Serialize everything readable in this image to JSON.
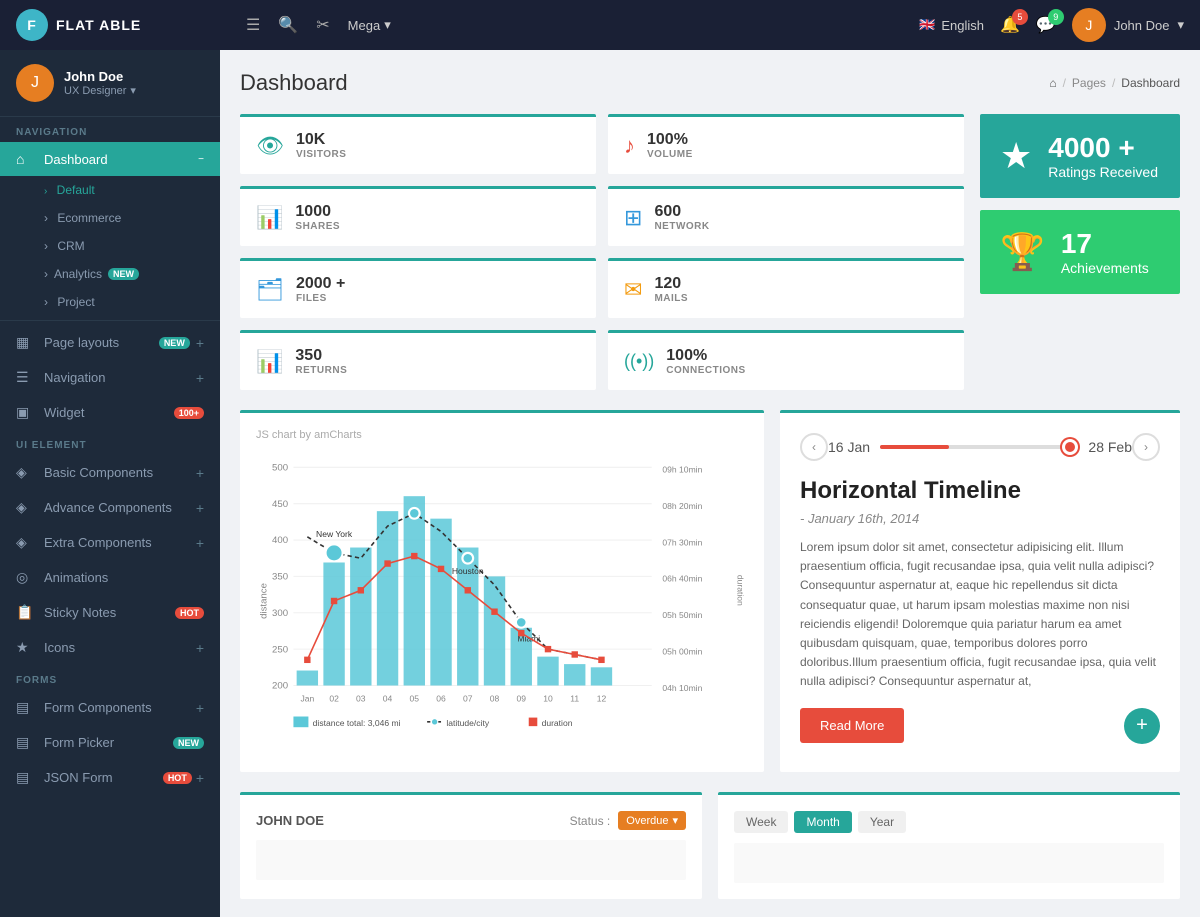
{
  "app": {
    "name": "FLAT ABLE",
    "logo_char": "F"
  },
  "topnav": {
    "hamburger": "☰",
    "search_icon": "🔍",
    "scissors_icon": "✂",
    "mega_label": "Mega",
    "lang": "English",
    "user_name": "John Doe",
    "notif_count": "5",
    "chat_count": "9"
  },
  "sidebar": {
    "user_name": "John Doe",
    "user_role": "UX Designer",
    "nav_section": "NAVIGATION",
    "ui_section": "UI ELEMENT",
    "forms_section": "FORMS",
    "items": [
      {
        "label": "Dashboard",
        "icon": "⌂",
        "active": true
      },
      {
        "label": "Default",
        "sub": true,
        "active": true
      },
      {
        "label": "Ecommerce",
        "sub": true
      },
      {
        "label": "CRM",
        "sub": true
      },
      {
        "label": "Analytics",
        "sub": true,
        "badge": "NEW",
        "badge_type": "new"
      },
      {
        "label": "Project",
        "sub": true
      },
      {
        "label": "Page layouts",
        "icon": "▦",
        "badge": "NEW",
        "badge_type": "new",
        "plus": true
      },
      {
        "label": "Navigation",
        "icon": "☰",
        "plus": true
      },
      {
        "label": "Widget",
        "icon": "▣",
        "badge": "100+",
        "badge_type": "hot"
      },
      {
        "label": "Basic Components",
        "icon": "◈",
        "plus": true
      },
      {
        "label": "Advance Components",
        "icon": "◈",
        "plus": true
      },
      {
        "label": "Extra Components",
        "icon": "◈",
        "plus": true
      },
      {
        "label": "Animations",
        "icon": "◎"
      },
      {
        "label": "Sticky Notes",
        "icon": "📋",
        "badge": "HOT",
        "badge_type": "hot"
      },
      {
        "label": "Icons",
        "icon": "★",
        "plus": true
      },
      {
        "label": "Form Components",
        "icon": "▤",
        "plus": true
      },
      {
        "label": "Form Picker",
        "icon": "▤",
        "badge": "NEW",
        "badge_type": "new"
      },
      {
        "label": "JSON Form",
        "icon": "▤",
        "badge": "HOT",
        "badge_type": "hot",
        "plus": true
      }
    ]
  },
  "page": {
    "title": "Dashboard",
    "breadcrumb": [
      "Pages",
      "Dashboard"
    ]
  },
  "stats": [
    {
      "value": "10K",
      "label": "VISITORS",
      "icon": "👁",
      "color": "teal"
    },
    {
      "value": "100%",
      "label": "VOLUME",
      "icon": "♪",
      "color": "red"
    },
    {
      "value": "1000",
      "label": "SHARES",
      "icon": "📊",
      "color": "teal"
    },
    {
      "value": "600",
      "label": "NETWORK",
      "icon": "⊞",
      "color": "blue"
    },
    {
      "value": "2000 +",
      "label": "FILES",
      "icon": "🗂",
      "color": "blue"
    },
    {
      "value": "120",
      "label": "MAILS",
      "icon": "✉",
      "color": "yellow"
    },
    {
      "value": "350",
      "label": "RETURNS",
      "icon": "📊",
      "color": "teal"
    },
    {
      "value": "100%",
      "label": "CONNECTIONS",
      "icon": "((•))",
      "color": "teal"
    }
  ],
  "big_stats": [
    {
      "value": "4000 +",
      "label": "Ratings Received",
      "icon": "★",
      "bg": "teal"
    },
    {
      "value": "17",
      "label": "Achievements",
      "icon": "🏆",
      "bg": "green"
    }
  ],
  "chart": {
    "title": "JS chart by amCharts",
    "y_label": "distance",
    "x_labels": [
      "Jan",
      "02",
      "03",
      "04",
      "05",
      "06",
      "07",
      "08",
      "09",
      "10",
      "11",
      "12"
    ],
    "y_ticks": [
      "500",
      "450",
      "400",
      "350",
      "300",
      "250",
      "200"
    ],
    "duration_ticks": [
      "09h 10min",
      "08h 20min",
      "07h 30min",
      "06h 40min",
      "05h 50min",
      "05h 00min",
      "04h 10min"
    ],
    "duration_label": "duration",
    "legend": [
      {
        "color": "#5bc8d8",
        "label": "distance total: 3,046 mi"
      },
      {
        "color": "#333",
        "dash": true,
        "label": "latitude/city"
      },
      {
        "color": "#e74c3c",
        "square": true,
        "label": "duration"
      }
    ],
    "cities": [
      "New York",
      "Miami",
      "Houston"
    ],
    "bars": [
      220,
      370,
      390,
      440,
      460,
      430,
      390,
      350,
      280,
      240,
      230,
      225
    ]
  },
  "timeline": {
    "date_start": "16 Jan",
    "date_end": "28 Feb",
    "title": "Horizontal Timeline",
    "subtitle": "- January 16th, 2014",
    "text": "Lorem ipsum dolor sit amet, consectetur adipisicing elit. Illum praesentium officia, fugit recusandae ipsa, quia velit nulla adipisci? Consequuntur aspernatur at, eaque hic repellendus sit dicta consequatur quae, ut harum ipsam molestias maxime non nisi reiciendis eligendi! Doloremque quia pariatur harum ea amet quibusdam quisquam, quae, temporibus dolores porro doloribus.Illum praesentium officia, fugit recusandae ipsa, quia velit nulla adipisci? Consequuntur aspernatur at,",
    "read_more": "Read More",
    "add_btn": "+"
  },
  "bottom": {
    "left": {
      "title": "JOHN DOE",
      "status_label": "Status :",
      "status_value": "Overdue"
    },
    "right": {
      "periods": [
        "Week",
        "Month",
        "Year"
      ],
      "active_period": "Month"
    }
  }
}
